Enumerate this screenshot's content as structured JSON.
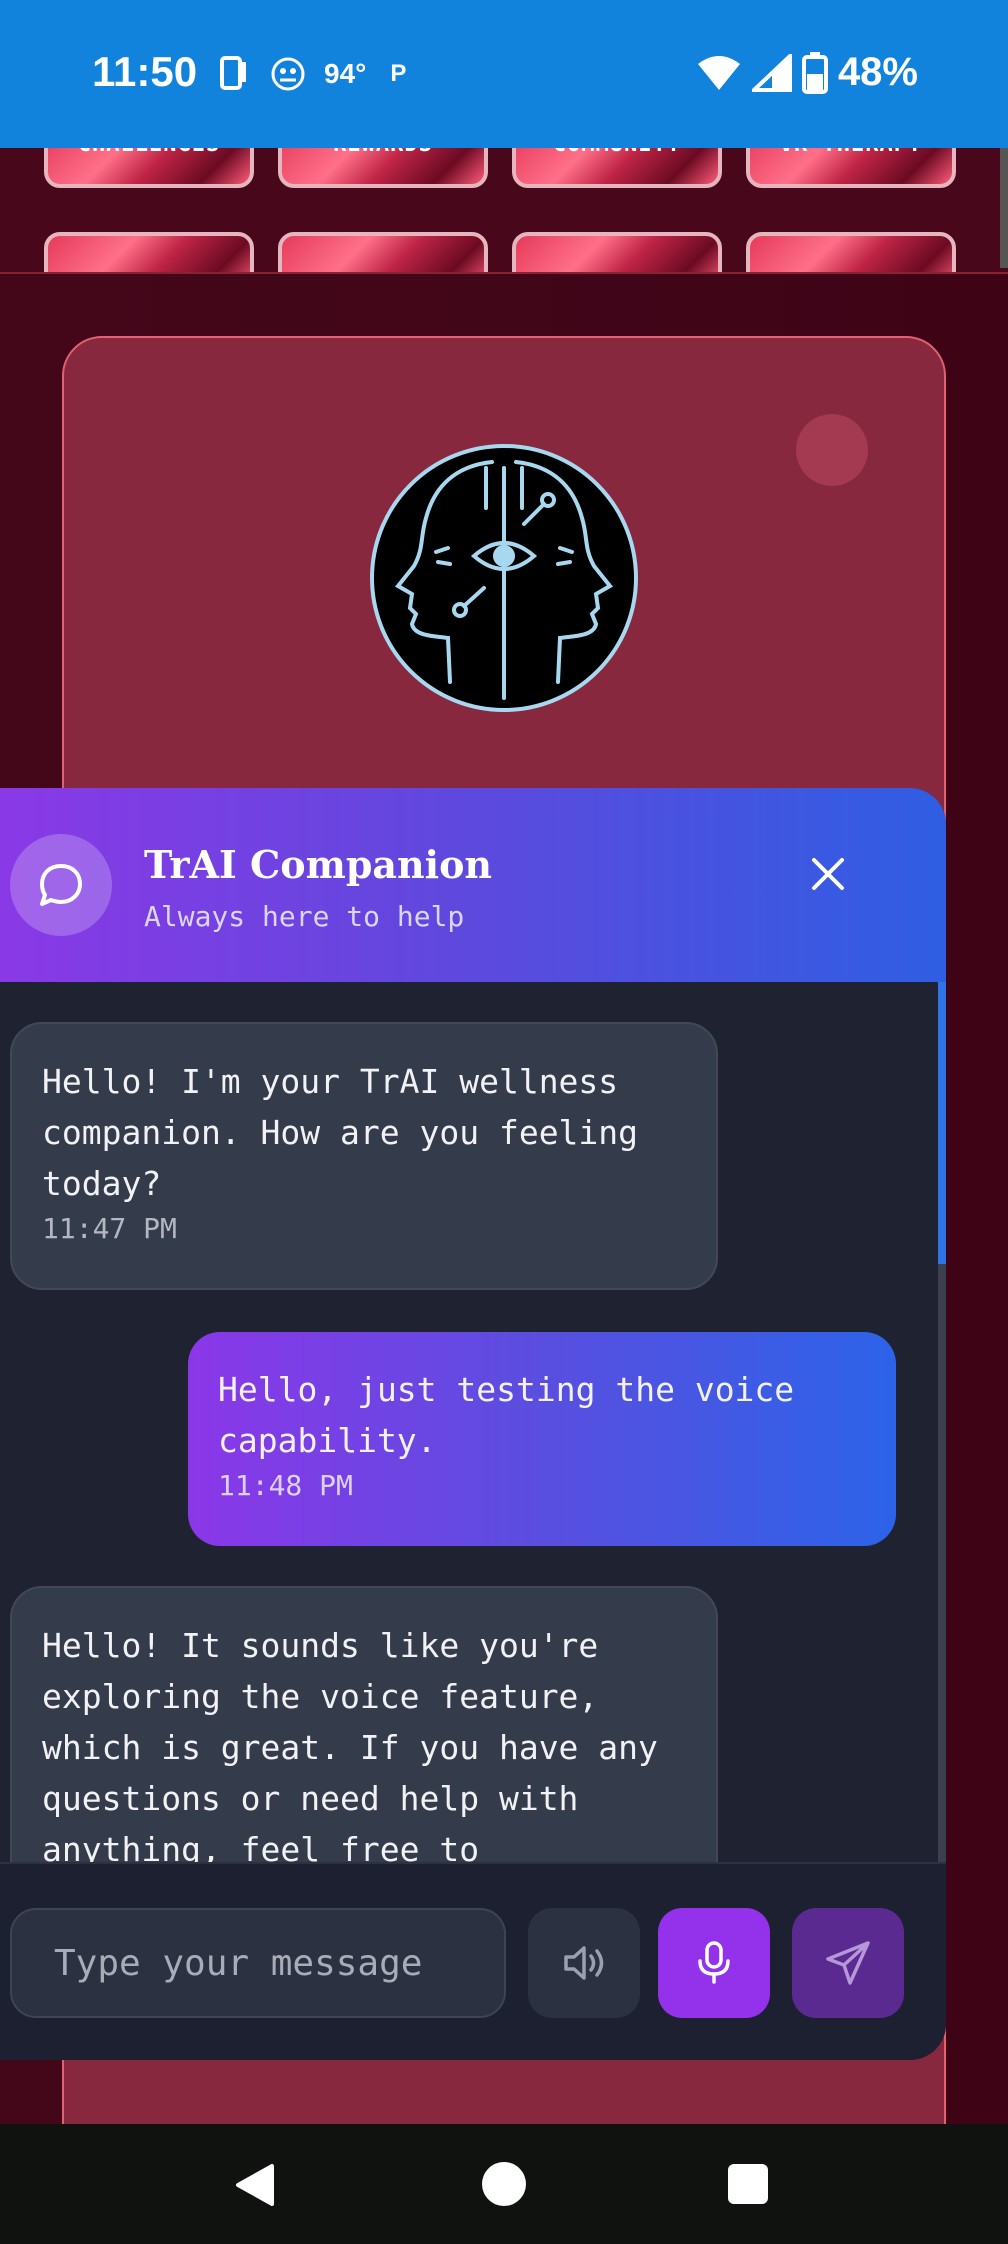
{
  "status_bar": {
    "time": "11:50",
    "temperature": "94°",
    "carrier_glyph": "P",
    "battery": "48%"
  },
  "tiles": {
    "row1": [
      "CHALLENGES",
      "REWARDS",
      "COMMUNITY",
      "VR THERAPY"
    ]
  },
  "chat": {
    "title": "TrAI Companion",
    "subtitle": "Always here to help",
    "messages": [
      {
        "role": "ai",
        "text": "Hello! I'm your TrAI wellness companion. How are you feeling today?",
        "time": "11:47 PM"
      },
      {
        "role": "user",
        "text": "Hello, just testing the voice capability.",
        "time": "11:48 PM"
      },
      {
        "role": "ai",
        "text": "Hello! It sounds like you're exploring the voice feature, which is great. If you have any questions or need help with anything, feel free to",
        "time": ""
      }
    ],
    "input_placeholder": "Type your message"
  },
  "colors": {
    "status_bar": "#1283dd",
    "brand_purple": "#8b37e8",
    "brand_blue": "#2c63e8",
    "mic_button": "#9332ea",
    "card": "#87283f"
  }
}
